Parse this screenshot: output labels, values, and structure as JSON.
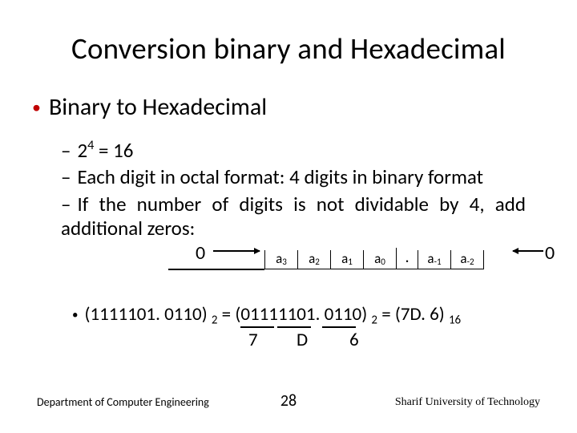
{
  "title": "Conversion binary and Hexadecimal",
  "main_bullet": "Binary to Hexadecimal",
  "sub1": {
    "two": "2",
    "four": "4",
    "eq16": " = 16"
  },
  "sub2": "Each digit in octal format: 4 digits in binary format",
  "sub3": "If the number of digits is not dividable by 4, add additional zeros:",
  "diagram": {
    "zero_left": "0",
    "zero_right": "0",
    "cells": [
      {
        "base": "a",
        "sub": "3"
      },
      {
        "base": "a",
        "sub": "2"
      },
      {
        "base": "a",
        "sub": "1"
      },
      {
        "base": "a",
        "sub": "0"
      },
      {
        "dot": "."
      },
      {
        "base": "a",
        "sub": "-1"
      },
      {
        "base": "a",
        "sub": "-2"
      }
    ]
  },
  "example": {
    "lhs_open": "(",
    "lhs_num": "1111101. 0110)",
    "lhs_sub": "2",
    "mid_eq": "= (",
    "grouped_text": "01111101. 0110",
    "mid_close": ")",
    "mid_sub": "2",
    "rhs_eq": "= (7D. 6)",
    "rhs_sub": "16",
    "h7": "7",
    "hd": "D",
    "h6": "6"
  },
  "footer": {
    "left": "Department of Computer Engineering",
    "page": "28",
    "right": "Sharif University of Technology"
  }
}
